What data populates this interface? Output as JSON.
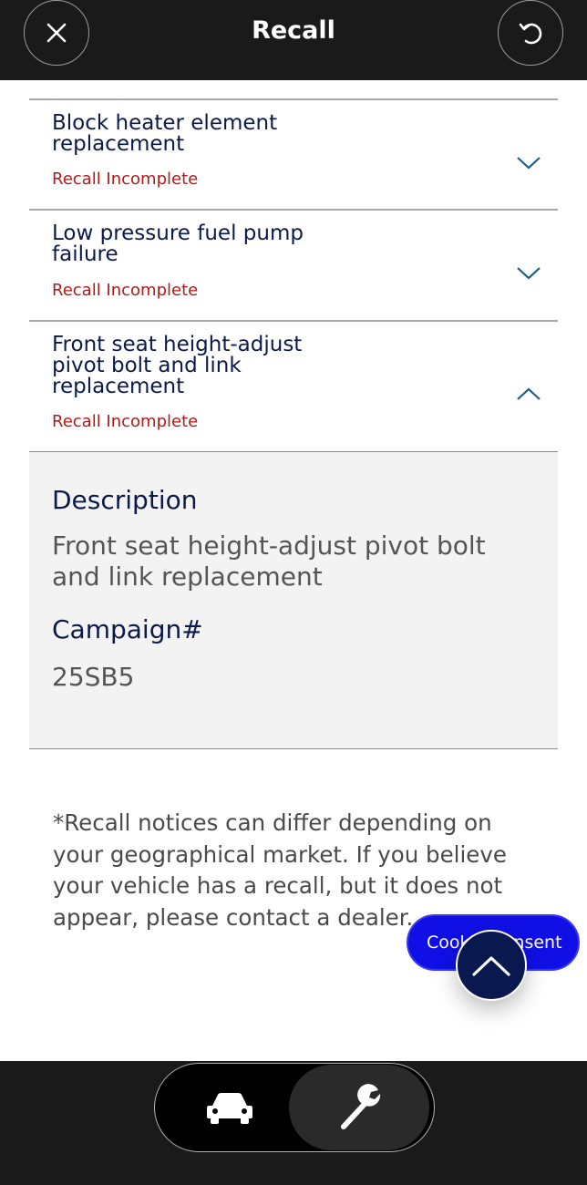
{
  "header": {
    "title": "Recall",
    "close_icon": "close-icon",
    "refresh_icon": "refresh-icon"
  },
  "recalls": [
    {
      "name": "Block heater element replacement",
      "status": "Recall Incomplete",
      "expanded": false
    },
    {
      "name": "Low pressure fuel pump failure",
      "status": "Recall Incomplete",
      "expanded": false
    },
    {
      "name": "Front seat height-adjust pivot bolt and link replacement",
      "status": "Recall Incomplete",
      "expanded": true
    }
  ],
  "detail": {
    "description_label": "Description",
    "description_value": "Front seat height-adjust pivot bolt and link replacement",
    "campaign_label": "Campaign#",
    "campaign_value": "25SB5"
  },
  "disclaimer": "*Recall notices can differ depending on your geographical market. If you believe your vehicle has a recall, but it does not appear, please contact a dealer.",
  "cookie_button": "Cookie Consent",
  "bottom_nav": {
    "items": [
      {
        "icon": "car-icon",
        "active": false
      },
      {
        "icon": "wrench-icon",
        "active": true
      }
    ]
  },
  "colors": {
    "header_bg": "#1a1a1a",
    "title_text": "#0c1a4a",
    "status_red": "#b31b1b",
    "chevron": "#1b5f86",
    "cookie_bg": "#1010e6",
    "scroll_top_bg": "#0a1850"
  }
}
